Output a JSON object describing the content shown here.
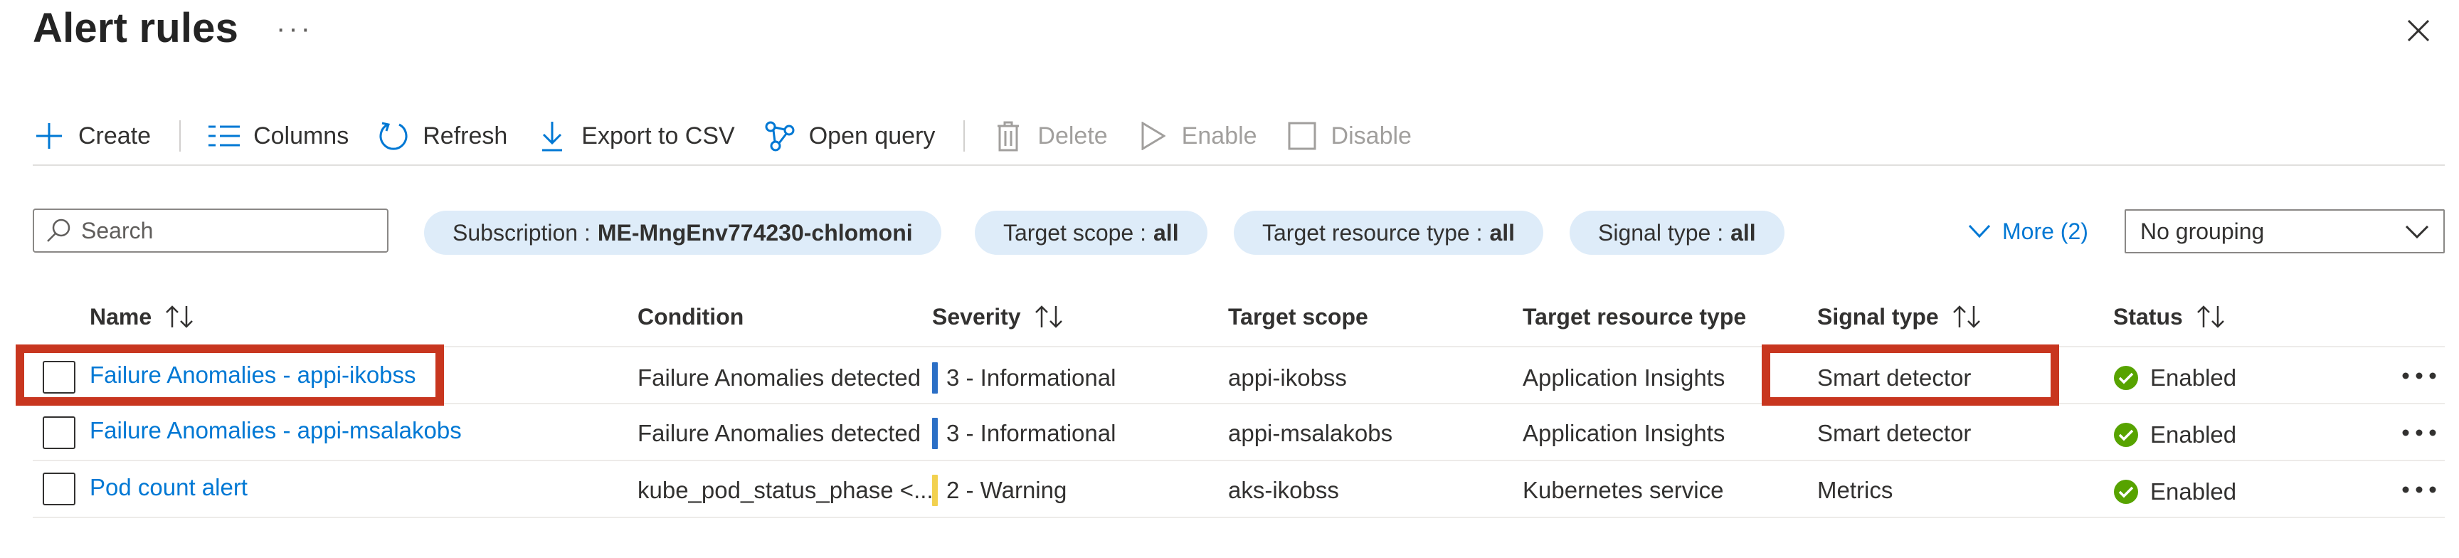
{
  "header": {
    "title": "Alert rules",
    "more": "···"
  },
  "toolbar": {
    "create": "Create",
    "columns": "Columns",
    "refresh": "Refresh",
    "export": "Export to CSV",
    "open_query": "Open query",
    "delete": "Delete",
    "enable": "Enable",
    "disable": "Disable"
  },
  "filters": {
    "search_placeholder": "Search",
    "subscription_label": "Subscription :",
    "subscription_value": "ME-MngEnv774230-chlomoni",
    "target_scope_label": "Target scope :",
    "target_scope_value": "all",
    "target_resource_type_label": "Target resource type :",
    "target_resource_type_value": "all",
    "signal_type_label": "Signal type :",
    "signal_type_value": "all",
    "more": "More (2)",
    "grouping": "No grouping"
  },
  "columns": {
    "name": "Name",
    "condition": "Condition",
    "severity": "Severity",
    "target_scope": "Target scope",
    "target_resource_type": "Target resource type",
    "signal_type": "Signal type",
    "status": "Status"
  },
  "rows": [
    {
      "name": "Failure Anomalies - appi-ikobss",
      "condition": "Failure Anomalies detected",
      "severity": "3 - Informational",
      "severity_color": "#2b6fc6",
      "target_scope": "appi-ikobss",
      "target_resource_type": "Application Insights",
      "signal_type": "Smart detector",
      "status": "Enabled"
    },
    {
      "name": "Failure Anomalies - appi-msalakobs",
      "condition": "Failure Anomalies detected",
      "severity": "3 - Informational",
      "severity_color": "#2b6fc6",
      "target_scope": "appi-msalakobs",
      "target_resource_type": "Application Insights",
      "signal_type": "Smart detector",
      "status": "Enabled"
    },
    {
      "name": "Pod count alert",
      "condition": "kube_pod_status_phase <...",
      "severity": "2 - Warning",
      "severity_color": "#f2d14f",
      "target_scope": "aks-ikobss",
      "target_resource_type": "Kubernetes service",
      "signal_type": "Metrics",
      "status": "Enabled"
    }
  ],
  "colors": {
    "accent": "#0078d4",
    "status_ok": "#57a300",
    "highlight": "#c8361f"
  }
}
